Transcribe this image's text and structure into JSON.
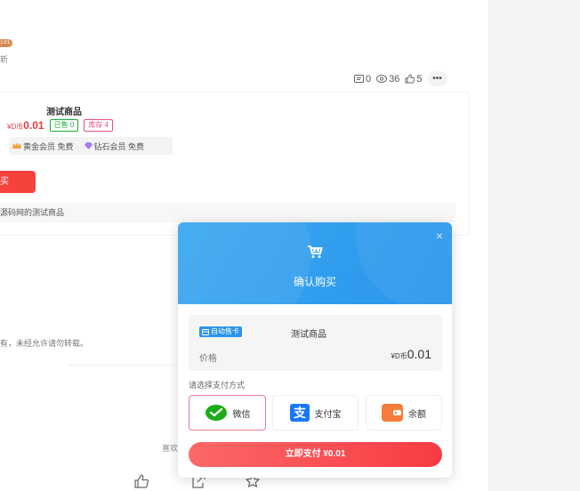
{
  "author": {
    "level_badge": "LV1",
    "subtitle": "新"
  },
  "stats": {
    "comments": "0",
    "views": "36",
    "likes": "5",
    "more": "•••"
  },
  "product": {
    "title": "测试商品",
    "price_prefix": "¥D币",
    "price": "0.01",
    "sold_tag": "已售 0",
    "stock_tag": "库存 4",
    "vip_gold": "黄金会员 免费",
    "vip_diamond": "钻石会员 免费",
    "buy_label": "买",
    "description": "源码网的测试商品"
  },
  "article": {
    "copyright": "有，未经允许请勿转载。",
    "like_text": "喜欢"
  },
  "modal": {
    "title": "确认购买",
    "close": "×",
    "auto_tag": "自动售卡",
    "product_name": "测试商品",
    "price_label": "价格",
    "price_prefix": "¥D币",
    "price": "0.01",
    "pay_method_label": "请选择支付方式",
    "pay_methods": [
      {
        "label": "微信",
        "icon": "wechat-icon",
        "color": "#1aad19"
      },
      {
        "label": "支付宝",
        "icon": "alipay-icon",
        "color": "#1677ff"
      },
      {
        "label": "余额",
        "icon": "wallet-icon",
        "color": "#f57c3a"
      }
    ],
    "pay_button": "立即支付  ¥0.01"
  },
  "colors": {
    "accent": "#2b93e8",
    "danger": "#f5423d"
  }
}
